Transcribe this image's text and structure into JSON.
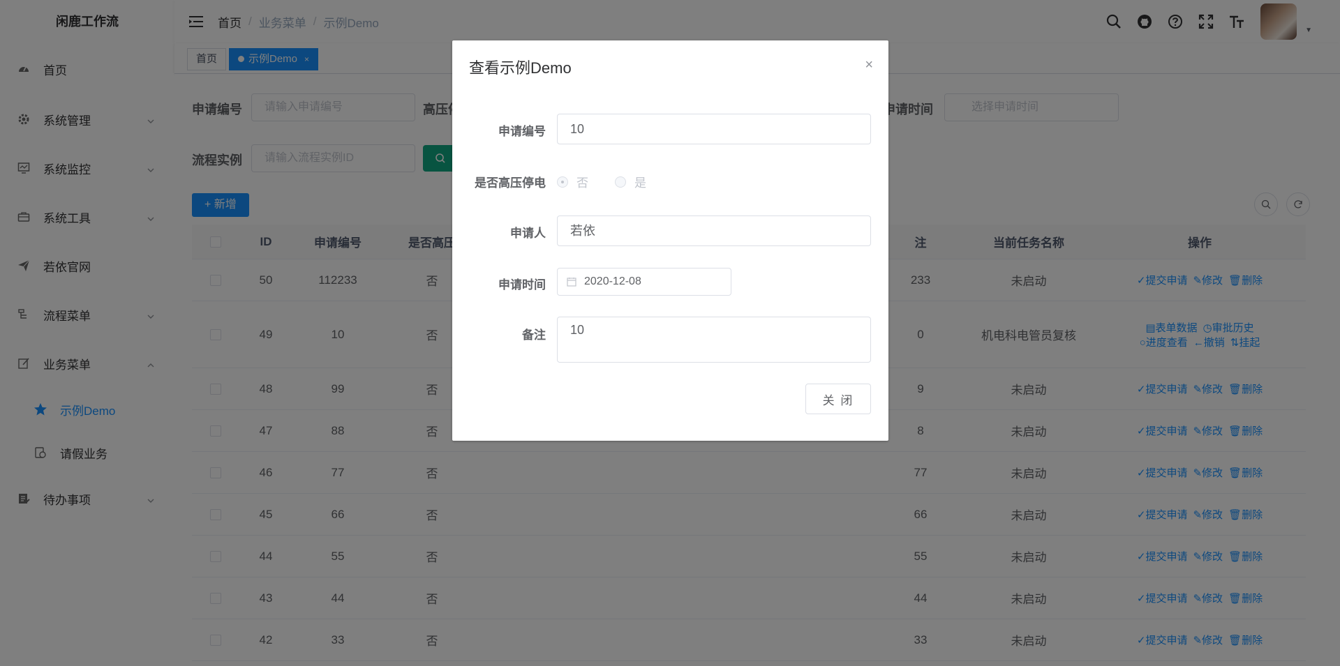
{
  "app": {
    "logo_text": "闲鹿工作流"
  },
  "sidebar": {
    "items": [
      {
        "label": "首页",
        "icon": "dashboard-icon"
      },
      {
        "label": "系统管理",
        "icon": "gear-icon"
      },
      {
        "label": "系统监控",
        "icon": "monitor-icon"
      },
      {
        "label": "系统工具",
        "icon": "toolbox-icon"
      },
      {
        "label": "若依官网",
        "icon": "paper-plane-icon"
      },
      {
        "label": "流程菜单",
        "icon": "flow-icon"
      },
      {
        "label": "业务菜单",
        "icon": "edit-icon"
      },
      {
        "label": "待办事项",
        "icon": "todo-icon"
      }
    ],
    "sub_items": [
      {
        "label": "示例Demo",
        "icon": "star-icon"
      },
      {
        "label": "请假业务",
        "icon": "leave-icon"
      }
    ]
  },
  "breadcrumb": [
    "首页",
    "业务菜单",
    "示例Demo"
  ],
  "tags": {
    "home": "首页",
    "active": "示例Demo",
    "close": "×"
  },
  "search_form": {
    "apply_no_label": "申请编号",
    "apply_no_placeholder": "请输入申请编号",
    "hv_label": "高压停电",
    "apply_time_label": "申请时间",
    "apply_time_placeholder": "选择申请时间",
    "flow_label": "流程实例",
    "flow_placeholder": "请输入流程实例ID"
  },
  "toolbar": {
    "add_label": "新增",
    "add_icon": "+"
  },
  "table": {
    "headers": {
      "id": "ID",
      "no": "申请编号",
      "hv": "是否高压",
      "bz": "注",
      "task": "当前任务名称",
      "op": "操作"
    },
    "rows": [
      {
        "id": "50",
        "no": "112233",
        "hv": "否",
        "bz": "233",
        "task": "未启动",
        "state": "draft"
      },
      {
        "id": "49",
        "no": "10",
        "hv": "否",
        "bz": "0",
        "task": "机电科电管员复核",
        "state": "running"
      },
      {
        "id": "48",
        "no": "99",
        "hv": "否",
        "bz": "9",
        "task": "未启动",
        "state": "draft"
      },
      {
        "id": "47",
        "no": "88",
        "hv": "否",
        "bz": "8",
        "task": "未启动",
        "state": "draft"
      },
      {
        "id": "46",
        "no": "77",
        "hv": "否",
        "bz": "77",
        "task": "未启动",
        "state": "draft"
      },
      {
        "id": "45",
        "no": "66",
        "hv": "否",
        "bz": "66",
        "task": "未启动",
        "state": "draft"
      },
      {
        "id": "44",
        "no": "55",
        "hv": "否",
        "bz": "55",
        "task": "未启动",
        "state": "draft"
      },
      {
        "id": "43",
        "no": "44",
        "hv": "否",
        "bz": "44",
        "task": "未启动",
        "state": "draft"
      },
      {
        "id": "42",
        "no": "33",
        "hv": "否",
        "bz": "33",
        "task": "未启动",
        "state": "draft"
      }
    ],
    "ops_draft": [
      "✓提交申请",
      "✎修改",
      "🗑删除"
    ],
    "ops_running": [
      "▤表单数据",
      "◷审批历史",
      "○进度查看",
      "←撤销",
      "⇅挂起"
    ]
  },
  "dialog": {
    "title": "查看示例Demo",
    "close": "×",
    "fields": {
      "apply_no_label": "申请编号",
      "apply_no_value": "10",
      "hv_label": "是否高压停电",
      "hv_no": "否",
      "hv_yes": "是",
      "applicant_label": "申请人",
      "applicant_value": "若依",
      "time_label": "申请时间",
      "time_value": "2020-12-08",
      "remark_label": "备注",
      "remark_value": "10"
    },
    "close_button": "关 闭"
  },
  "colors": {
    "primary": "#1890ff",
    "search_btn": "#11a983",
    "overlay": "rgba(0,0,0,0.5)"
  }
}
